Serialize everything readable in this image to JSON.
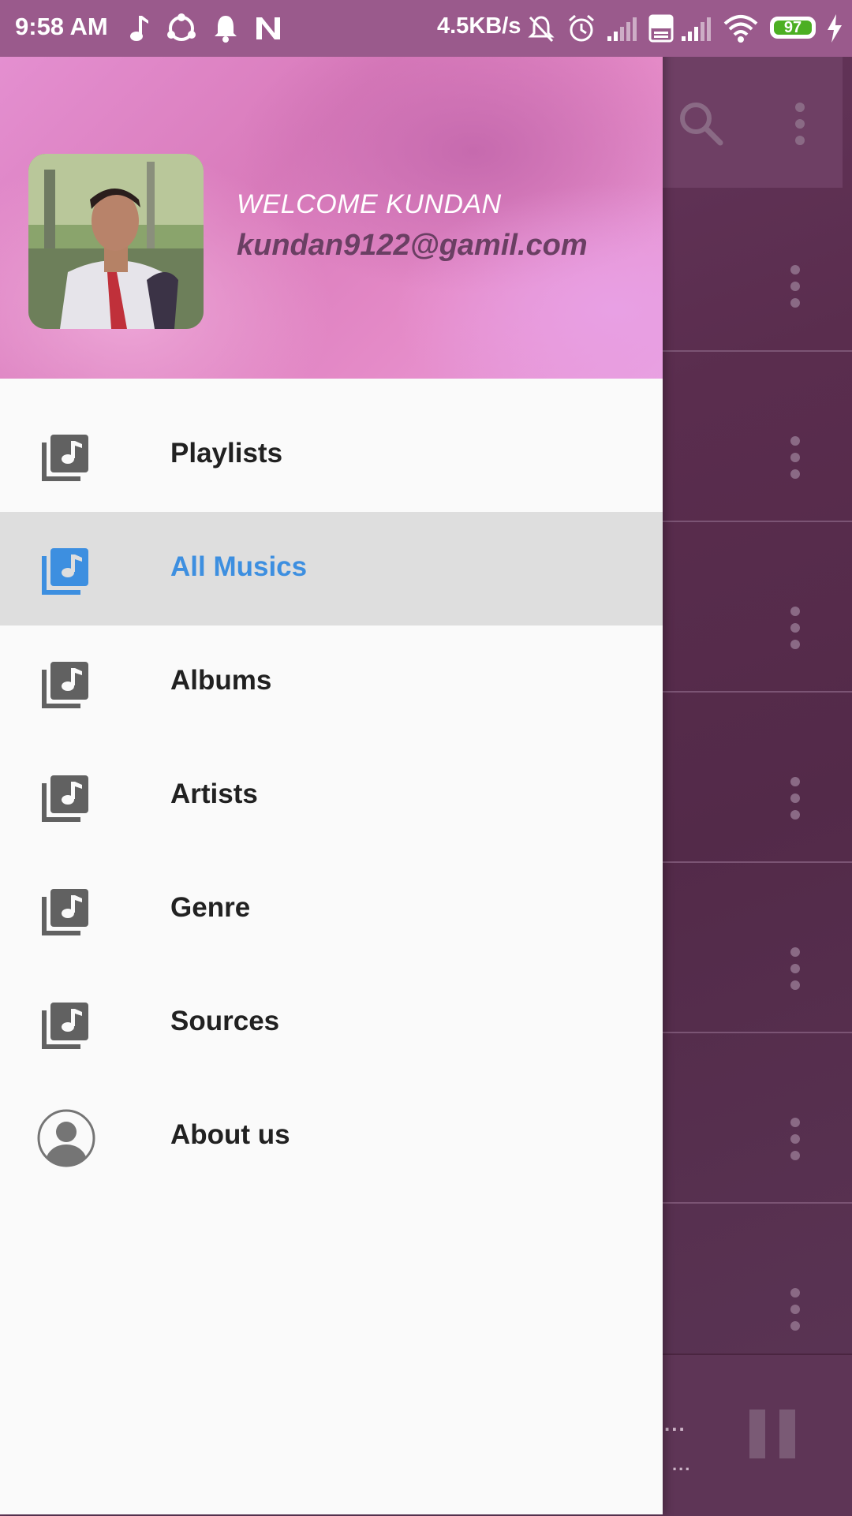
{
  "status_bar": {
    "time": "9:58 AM",
    "network_speed": "4.5KB/s",
    "battery_level": "97",
    "icons": [
      "music-note-icon",
      "share-it-icon",
      "notification-bell-icon",
      "n-app-icon",
      "mute-icon",
      "alarm-icon",
      "signal-icon",
      "volte-icon",
      "signal-icon",
      "wifi-icon",
      "battery-icon",
      "charging-icon"
    ]
  },
  "drawer": {
    "header": {
      "welcome": "WELCOME KUNDAN",
      "email": "kundan9122@gamil.com"
    },
    "items": [
      {
        "label": "Playlists",
        "icon": "music-library-icon",
        "selected": false
      },
      {
        "label": "All Musics",
        "icon": "music-library-icon",
        "selected": true
      },
      {
        "label": "Albums",
        "icon": "music-library-icon",
        "selected": false
      },
      {
        "label": "Artists",
        "icon": "music-library-icon",
        "selected": false
      },
      {
        "label": "Genre",
        "icon": "music-library-icon",
        "selected": false
      },
      {
        "label": "Sources",
        "icon": "music-library-icon",
        "selected": false
      },
      {
        "label": "About us",
        "icon": "person-icon",
        "selected": false
      }
    ]
  },
  "background_app": {
    "player_title": "...",
    "player_subtitle": "...",
    "icons": [
      "search-icon",
      "more-vert-icon",
      "pause-icon"
    ]
  },
  "colors": {
    "accent_selected": "#3d8fe0",
    "status_bar": "#9a5a8c",
    "drawer_background": "#fafafa",
    "selected_row": "#dedede"
  }
}
